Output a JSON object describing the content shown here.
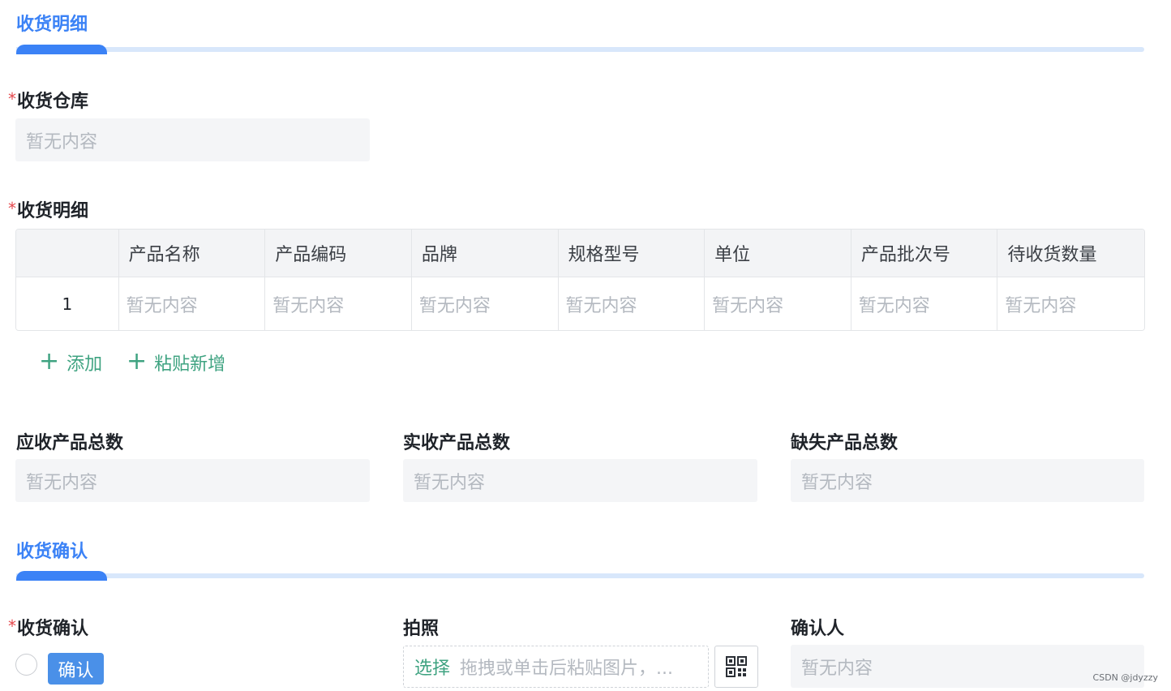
{
  "sections": {
    "receipt_detail": "收货明细",
    "receipt_confirm": "收货确认"
  },
  "fields": {
    "warehouse": {
      "required_mark": "*",
      "label": "收货仓库",
      "value": "暂无内容"
    },
    "detail": {
      "required_mark": "*",
      "label": "收货明细"
    },
    "expected_total": {
      "label": "应收产品总数",
      "value": "暂无内容"
    },
    "actual_total": {
      "label": "实收产品总数",
      "value": "暂无内容"
    },
    "missing_total": {
      "label": "缺失产品总数",
      "value": "暂无内容"
    },
    "confirm": {
      "required_mark": "*",
      "label": "收货确认",
      "button": "确认"
    },
    "photo": {
      "label": "拍照",
      "select": "选择",
      "hint": "拖拽或单击后粘贴图片，..."
    },
    "confirmer": {
      "label": "确认人",
      "value": "暂无内容"
    }
  },
  "table": {
    "headers": [
      "",
      "产品名称",
      "产品编码",
      "品牌",
      "规格型号",
      "单位",
      "产品批次号",
      "待收货数量"
    ],
    "rows": [
      [
        "1",
        "暂无内容",
        "暂无内容",
        "暂无内容",
        "暂无内容",
        "暂无内容",
        "暂无内容",
        "暂无内容"
      ]
    ]
  },
  "actions": {
    "add": "添加",
    "paste_add": "粘贴新增"
  },
  "icons": {
    "add": "plus-icon",
    "paste_add": "plus-icon",
    "qr": "qrcode-icon"
  },
  "colors": {
    "accent": "#3b82f6",
    "action_green": "#3fa381",
    "required_red": "#e5484d",
    "button_blue": "#4a90e8"
  },
  "watermark": "CSDN @jdyzzy"
}
